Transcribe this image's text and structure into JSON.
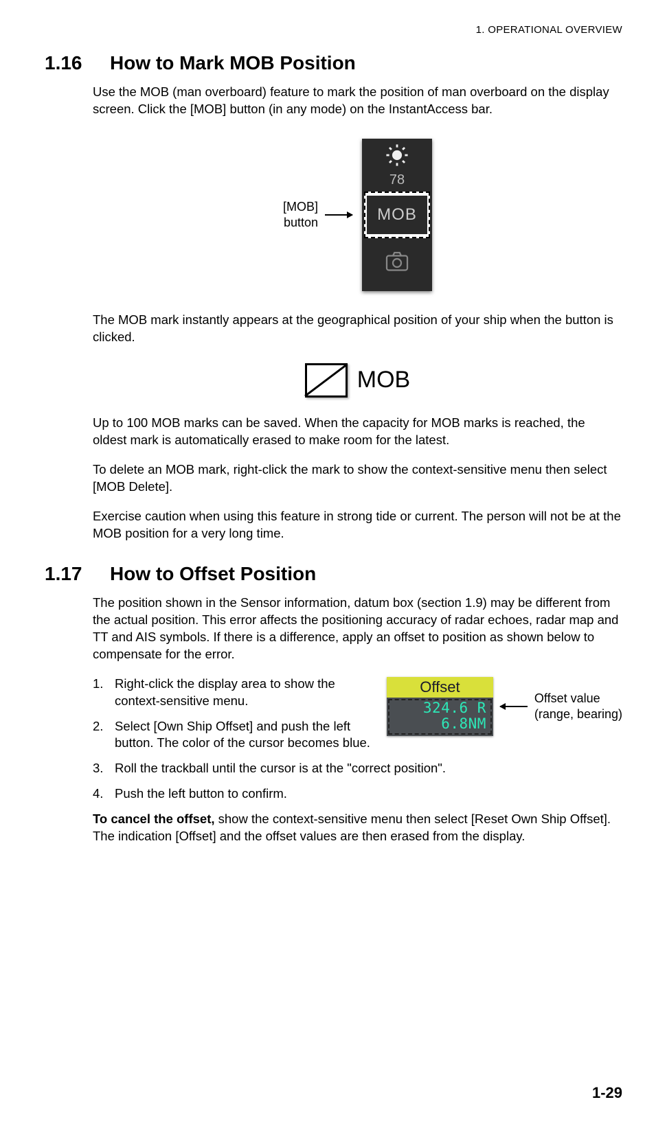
{
  "header": "1.  OPERATIONAL OVERVIEW",
  "section1": {
    "number": "1.16",
    "title": "How to Mark MOB Position",
    "para1": "Use the MOB (man overboard) feature to mark the position of man overboard on the display screen. Click the [MOB] button (in any mode) on the InstantAccess bar.",
    "fig1_label1": "[MOB]",
    "fig1_label2": "button",
    "ia_brightness_value": "78",
    "ia_mob_label": "MOB",
    "para2": "The MOB mark instantly appears at the geographical position of your ship when the button is clicked.",
    "mob_symbol_label": "MOB",
    "para3": "Up to 100 MOB marks can be saved. When the capacity for MOB marks is reached, the oldest mark is automatically erased to make room for the latest.",
    "para4": "To delete an MOB mark, right-click the mark to show the context-sensitive menu then select [MOB Delete].",
    "para5": "Exercise caution when using this feature in strong tide or current. The person will not be at the MOB position for a very long time."
  },
  "section2": {
    "number": "1.17",
    "title": "How to Offset Position",
    "para1": "The position shown in the Sensor information, datum box (section 1.9) may be different from the actual position. This error affects the positioning accuracy of radar echoes, radar map and TT and AIS symbols. If there is a difference, apply an offset to position as shown below to compensate for the error.",
    "steps": [
      "Right-click the display area to show the context-sensitive menu.",
      "Select [Own Ship Offset] and push the left button. The color of the cursor becomes blue.",
      "Roll the trackball until the cursor is at the \"correct position\".",
      "Push the left button to confirm."
    ],
    "offset_box_title": "Offset",
    "offset_val1": "324.6  R",
    "offset_val2": "6.8NM",
    "offset_annot1": "Offset value",
    "offset_annot2": "(range, bearing)",
    "cancel_bold": "To cancel the offset,",
    "cancel_rest": " show the context-sensitive menu then select [Reset Own Ship Offset]. The indication [Offset] and the offset values are then erased from the display."
  },
  "page_number": "1-29"
}
